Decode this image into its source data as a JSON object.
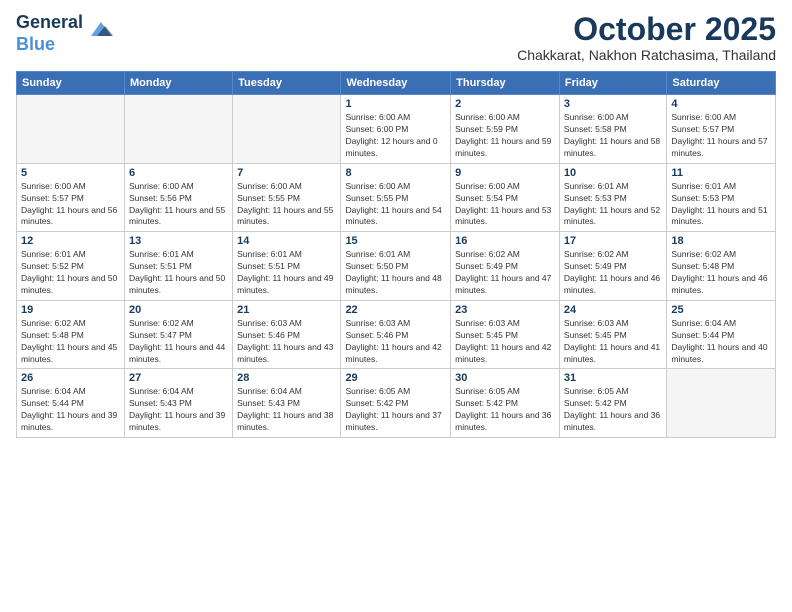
{
  "header": {
    "logo_line1": "General",
    "logo_line2": "Blue",
    "month": "October 2025",
    "location": "Chakkarat, Nakhon Ratchasima, Thailand"
  },
  "weekdays": [
    "Sunday",
    "Monday",
    "Tuesday",
    "Wednesday",
    "Thursday",
    "Friday",
    "Saturday"
  ],
  "weeks": [
    [
      {
        "day": "",
        "sunrise": "",
        "sunset": "",
        "daylight": "",
        "empty": true
      },
      {
        "day": "",
        "sunrise": "",
        "sunset": "",
        "daylight": "",
        "empty": true
      },
      {
        "day": "",
        "sunrise": "",
        "sunset": "",
        "daylight": "",
        "empty": true
      },
      {
        "day": "1",
        "sunrise": "Sunrise: 6:00 AM",
        "sunset": "Sunset: 6:00 PM",
        "daylight": "Daylight: 12 hours and 0 minutes."
      },
      {
        "day": "2",
        "sunrise": "Sunrise: 6:00 AM",
        "sunset": "Sunset: 5:59 PM",
        "daylight": "Daylight: 11 hours and 59 minutes."
      },
      {
        "day": "3",
        "sunrise": "Sunrise: 6:00 AM",
        "sunset": "Sunset: 5:58 PM",
        "daylight": "Daylight: 11 hours and 58 minutes."
      },
      {
        "day": "4",
        "sunrise": "Sunrise: 6:00 AM",
        "sunset": "Sunset: 5:57 PM",
        "daylight": "Daylight: 11 hours and 57 minutes."
      }
    ],
    [
      {
        "day": "5",
        "sunrise": "Sunrise: 6:00 AM",
        "sunset": "Sunset: 5:57 PM",
        "daylight": "Daylight: 11 hours and 56 minutes."
      },
      {
        "day": "6",
        "sunrise": "Sunrise: 6:00 AM",
        "sunset": "Sunset: 5:56 PM",
        "daylight": "Daylight: 11 hours and 55 minutes."
      },
      {
        "day": "7",
        "sunrise": "Sunrise: 6:00 AM",
        "sunset": "Sunset: 5:55 PM",
        "daylight": "Daylight: 11 hours and 55 minutes."
      },
      {
        "day": "8",
        "sunrise": "Sunrise: 6:00 AM",
        "sunset": "Sunset: 5:55 PM",
        "daylight": "Daylight: 11 hours and 54 minutes."
      },
      {
        "day": "9",
        "sunrise": "Sunrise: 6:00 AM",
        "sunset": "Sunset: 5:54 PM",
        "daylight": "Daylight: 11 hours and 53 minutes."
      },
      {
        "day": "10",
        "sunrise": "Sunrise: 6:01 AM",
        "sunset": "Sunset: 5:53 PM",
        "daylight": "Daylight: 11 hours and 52 minutes."
      },
      {
        "day": "11",
        "sunrise": "Sunrise: 6:01 AM",
        "sunset": "Sunset: 5:53 PM",
        "daylight": "Daylight: 11 hours and 51 minutes."
      }
    ],
    [
      {
        "day": "12",
        "sunrise": "Sunrise: 6:01 AM",
        "sunset": "Sunset: 5:52 PM",
        "daylight": "Daylight: 11 hours and 50 minutes."
      },
      {
        "day": "13",
        "sunrise": "Sunrise: 6:01 AM",
        "sunset": "Sunset: 5:51 PM",
        "daylight": "Daylight: 11 hours and 50 minutes."
      },
      {
        "day": "14",
        "sunrise": "Sunrise: 6:01 AM",
        "sunset": "Sunset: 5:51 PM",
        "daylight": "Daylight: 11 hours and 49 minutes."
      },
      {
        "day": "15",
        "sunrise": "Sunrise: 6:01 AM",
        "sunset": "Sunset: 5:50 PM",
        "daylight": "Daylight: 11 hours and 48 minutes."
      },
      {
        "day": "16",
        "sunrise": "Sunrise: 6:02 AM",
        "sunset": "Sunset: 5:49 PM",
        "daylight": "Daylight: 11 hours and 47 minutes."
      },
      {
        "day": "17",
        "sunrise": "Sunrise: 6:02 AM",
        "sunset": "Sunset: 5:49 PM",
        "daylight": "Daylight: 11 hours and 46 minutes."
      },
      {
        "day": "18",
        "sunrise": "Sunrise: 6:02 AM",
        "sunset": "Sunset: 5:48 PM",
        "daylight": "Daylight: 11 hours and 46 minutes."
      }
    ],
    [
      {
        "day": "19",
        "sunrise": "Sunrise: 6:02 AM",
        "sunset": "Sunset: 5:48 PM",
        "daylight": "Daylight: 11 hours and 45 minutes."
      },
      {
        "day": "20",
        "sunrise": "Sunrise: 6:02 AM",
        "sunset": "Sunset: 5:47 PM",
        "daylight": "Daylight: 11 hours and 44 minutes."
      },
      {
        "day": "21",
        "sunrise": "Sunrise: 6:03 AM",
        "sunset": "Sunset: 5:46 PM",
        "daylight": "Daylight: 11 hours and 43 minutes."
      },
      {
        "day": "22",
        "sunrise": "Sunrise: 6:03 AM",
        "sunset": "Sunset: 5:46 PM",
        "daylight": "Daylight: 11 hours and 42 minutes."
      },
      {
        "day": "23",
        "sunrise": "Sunrise: 6:03 AM",
        "sunset": "Sunset: 5:45 PM",
        "daylight": "Daylight: 11 hours and 42 minutes."
      },
      {
        "day": "24",
        "sunrise": "Sunrise: 6:03 AM",
        "sunset": "Sunset: 5:45 PM",
        "daylight": "Daylight: 11 hours and 41 minutes."
      },
      {
        "day": "25",
        "sunrise": "Sunrise: 6:04 AM",
        "sunset": "Sunset: 5:44 PM",
        "daylight": "Daylight: 11 hours and 40 minutes."
      }
    ],
    [
      {
        "day": "26",
        "sunrise": "Sunrise: 6:04 AM",
        "sunset": "Sunset: 5:44 PM",
        "daylight": "Daylight: 11 hours and 39 minutes."
      },
      {
        "day": "27",
        "sunrise": "Sunrise: 6:04 AM",
        "sunset": "Sunset: 5:43 PM",
        "daylight": "Daylight: 11 hours and 39 minutes."
      },
      {
        "day": "28",
        "sunrise": "Sunrise: 6:04 AM",
        "sunset": "Sunset: 5:43 PM",
        "daylight": "Daylight: 11 hours and 38 minutes."
      },
      {
        "day": "29",
        "sunrise": "Sunrise: 6:05 AM",
        "sunset": "Sunset: 5:42 PM",
        "daylight": "Daylight: 11 hours and 37 minutes."
      },
      {
        "day": "30",
        "sunrise": "Sunrise: 6:05 AM",
        "sunset": "Sunset: 5:42 PM",
        "daylight": "Daylight: 11 hours and 36 minutes."
      },
      {
        "day": "31",
        "sunrise": "Sunrise: 6:05 AM",
        "sunset": "Sunset: 5:42 PM",
        "daylight": "Daylight: 11 hours and 36 minutes."
      },
      {
        "day": "",
        "sunrise": "",
        "sunset": "",
        "daylight": "",
        "empty": true
      }
    ]
  ]
}
